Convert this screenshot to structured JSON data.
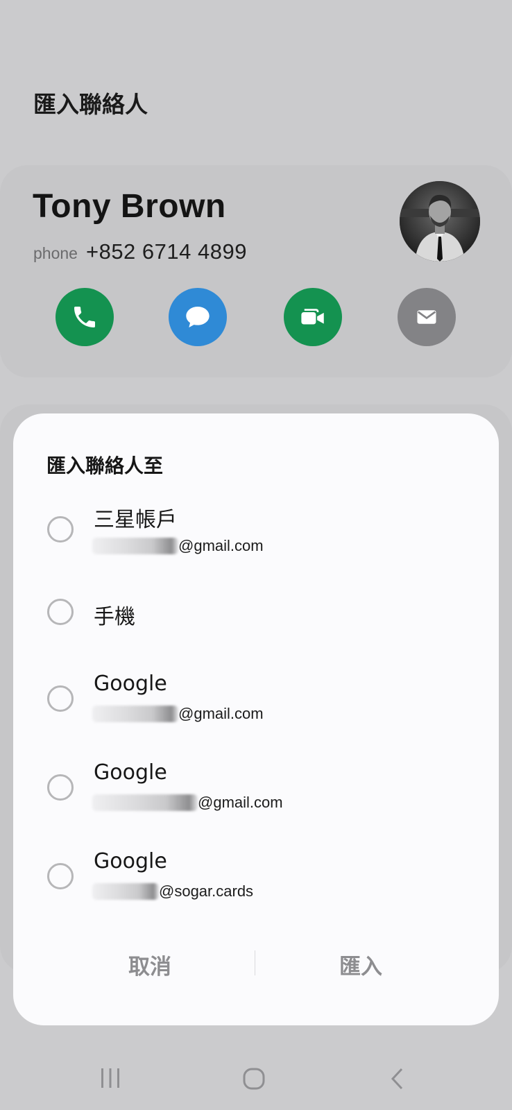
{
  "screen": {
    "title": "匯入聯絡人"
  },
  "contact": {
    "name": "Tony Brown",
    "phone_label": "phone",
    "phone_number": "+852 6714 4899",
    "actions": [
      {
        "name": "call",
        "icon": "phone-icon",
        "color": "#149250"
      },
      {
        "name": "message",
        "icon": "chat-bubble-icon",
        "color": "#2f8ad6"
      },
      {
        "name": "video",
        "icon": "video-camera-icon",
        "color": "#149250"
      },
      {
        "name": "email",
        "icon": "envelope-icon",
        "color": "#838386"
      }
    ]
  },
  "dialog": {
    "title": "匯入聯絡人至",
    "options": [
      {
        "name": "三星帳戶",
        "email": "@gmail.com",
        "selected": false
      },
      {
        "name": "手機",
        "email": "",
        "selected": false
      },
      {
        "name": "Google",
        "email": "@gmail.com",
        "selected": false
      },
      {
        "name": "Google",
        "email": "@gmail.com",
        "selected": false
      },
      {
        "name": "Google",
        "email": "@sogar.cards",
        "selected": false
      }
    ],
    "cancel_label": "取消",
    "import_label": "匯入"
  },
  "navbar": {
    "icons": [
      "recent-apps-icon",
      "home-icon",
      "back-icon"
    ]
  }
}
